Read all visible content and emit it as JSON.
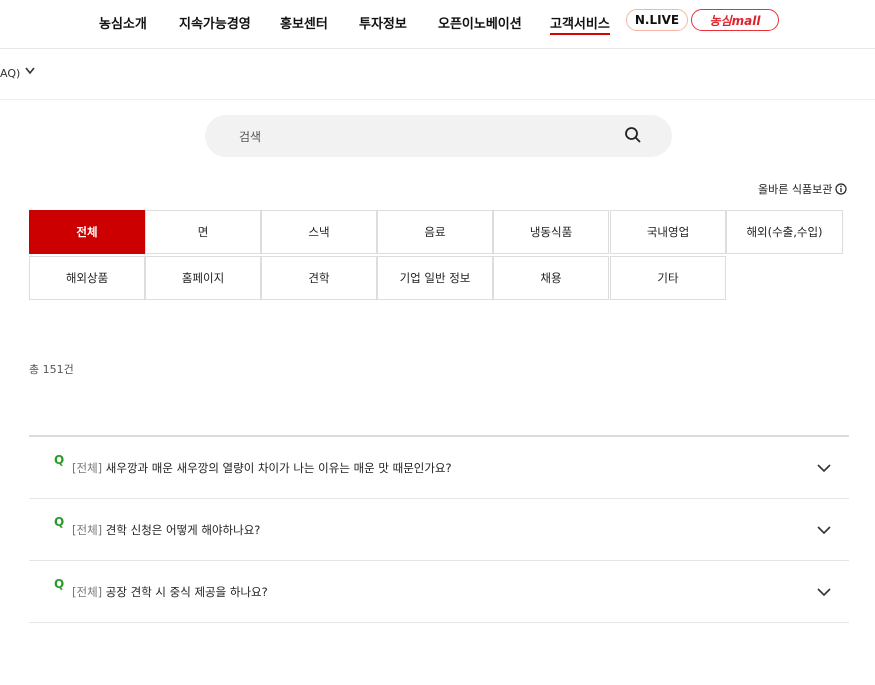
{
  "nav": {
    "items": [
      "농심소개",
      "지속가능경영",
      "홍보센터",
      "투자정보",
      "오픈이노베이션",
      "고객서비스"
    ],
    "live_label": "N.LIVE",
    "mall_label": "농심mall",
    "accent": "#d00000"
  },
  "breadcrumb": {
    "label": "AQ)"
  },
  "search": {
    "placeholder": "검색"
  },
  "storage_link": {
    "label": "올바른 식품보관"
  },
  "categories": [
    "전체",
    "면",
    "스낵",
    "음료",
    "냉동식품",
    "국내영업",
    "해외(수출,수입)",
    "해외상품",
    "홈페이지",
    "견학",
    "기업 일반 정보",
    "채용",
    "기타"
  ],
  "active_category": "전체",
  "total": "총 151건",
  "faq": [
    {
      "q": "Q",
      "category": "[전체]",
      "question": "새우깡과 매운 새우깡의 열량이 차이가 나는 이유는 매운 맛 때문인가요?"
    },
    {
      "q": "Q",
      "category": "[전체]",
      "question": "견학 신청은 어떻게 해야하나요?"
    },
    {
      "q": "Q",
      "category": "[전체]",
      "question": "공장 견학 시 중식 제공을 하나요?"
    }
  ]
}
